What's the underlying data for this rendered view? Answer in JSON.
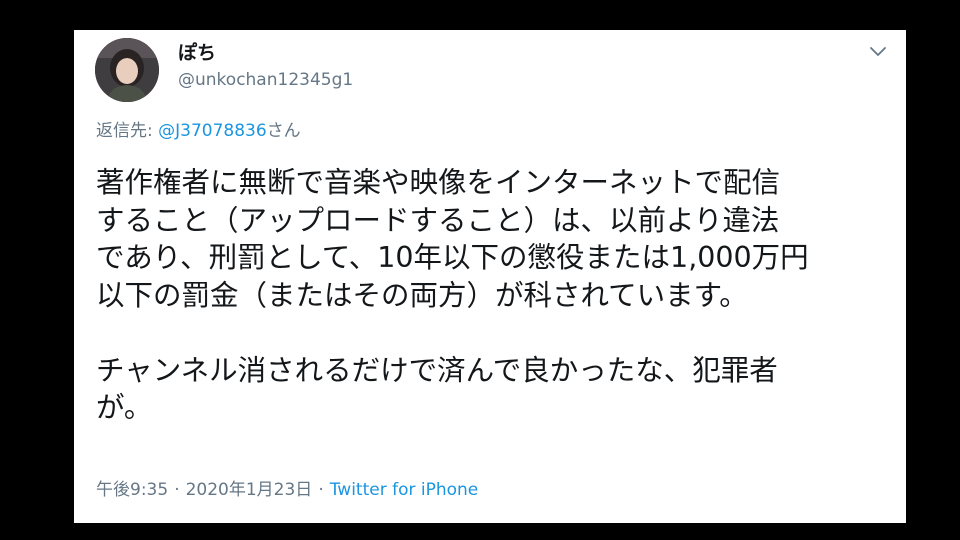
{
  "tweet": {
    "author": {
      "display_name": "ぽち",
      "handle": "@unkochan12345g1",
      "avatar_icon": "user-photo-avatar"
    },
    "menu_icon": "chevron-down-icon",
    "reply": {
      "prefix": "返信先: ",
      "mention": "@J37078836",
      "suffix": "さん"
    },
    "lines": [
      "著作権者に無断で音楽や映像をインターネットで配信",
      "すること（アップロードすること）は、以前より違法",
      "であり、刑罰として、10年以下の懲役または1,000万円",
      "以下の罰金（またはその両方）が科されています。",
      "",
      "チャンネル消されるだけで済んで良かったな、犯罪者",
      "が。"
    ],
    "time": "午後9:35",
    "separator": "·",
    "date": "2020年1月23日",
    "source": "Twitter for iPhone"
  },
  "colors": {
    "background": "#000000",
    "card": "#ffffff",
    "text": "#14171a",
    "secondary": "#657786",
    "link": "#1b95e0"
  }
}
